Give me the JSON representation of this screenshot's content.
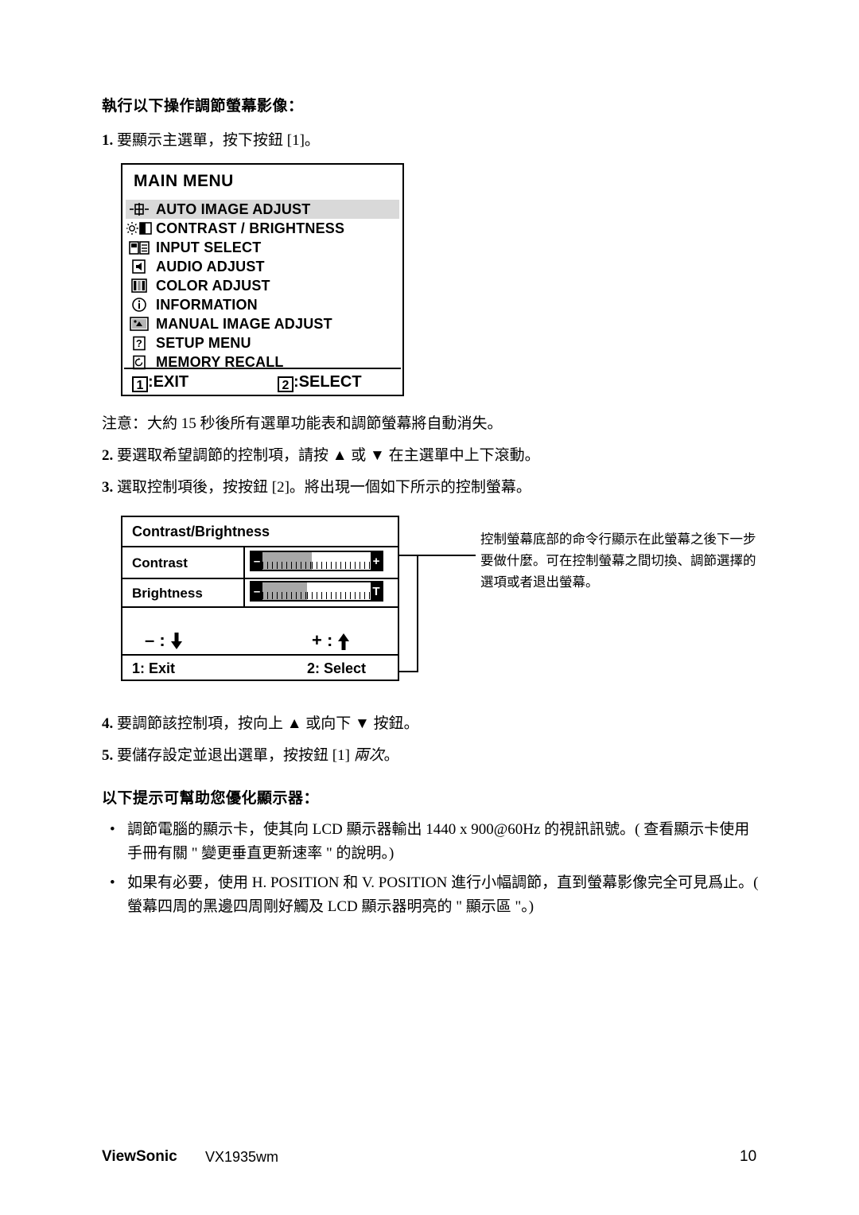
{
  "section1": {
    "heading": "執行以下操作調節螢幕影像：",
    "step1_num": "1.",
    "step1_text": "要顯示主選單，按下按鈕 [1]。",
    "note": "注意：大約 15 秒後所有選單功能表和調節螢幕將自動消失。",
    "step2_num": "2.",
    "step2_text": "要選取希望調節的控制項，請按 ▲ 或 ▼ 在主選單中上下滾動。",
    "step3_num": "3.",
    "step3_text": "選取控制項後，按按鈕 [2]。將出現一個如下所示的控制螢幕。",
    "step4_num": "4.",
    "step4_text": "要調節該控制項，按向上 ▲ 或向下 ▼ 按鈕。",
    "step5_num": "5.",
    "step5_text_a": "要儲存設定並退出選單，按按鈕 [1] ",
    "step5_text_italic": "兩次",
    "step5_text_b": "。"
  },
  "osd_main": {
    "title": "MAIN MENU",
    "items": [
      {
        "label": "AUTO IMAGE ADJUST",
        "icon": "auto-image-adjust-icon",
        "selected": true
      },
      {
        "label": "CONTRAST / BRIGHTNESS",
        "icon": "contrast-brightness-icon",
        "selected": false
      },
      {
        "label": "INPUT SELECT",
        "icon": "input-select-icon",
        "selected": false
      },
      {
        "label": "AUDIO ADJUST",
        "icon": "audio-adjust-icon",
        "selected": false
      },
      {
        "label": "COLOR ADJUST",
        "icon": "color-adjust-icon",
        "selected": false
      },
      {
        "label": "INFORMATION",
        "icon": "information-icon",
        "selected": false
      },
      {
        "label": "MANUAL IMAGE ADJUST",
        "icon": "manual-image-adjust-icon",
        "selected": false
      },
      {
        "label": "SETUP MENU",
        "icon": "setup-menu-icon",
        "selected": false
      },
      {
        "label": "MEMORY RECALL",
        "icon": "memory-recall-icon",
        "selected": false
      }
    ],
    "footer_left_key": "1",
    "footer_left_label": ":EXIT",
    "footer_right_key": "2",
    "footer_right_label": ":SELECT"
  },
  "osd_contrast": {
    "title": "Contrast/Brightness",
    "rows": [
      {
        "label": "Contrast",
        "minus": "–",
        "plus": "+",
        "fill_percent": 48
      },
      {
        "label": "Brightness",
        "minus": "–",
        "plus": "T",
        "fill_percent": 44
      }
    ],
    "minus_symbol": "–  :",
    "plus_symbol": "+  :",
    "footer_left": "1: Exit",
    "footer_right": "2: Select"
  },
  "callout": {
    "text": "控制螢幕底部的命令行顯示在此螢幕之後下一步要做什麼。可在控制螢幕之間切換、調節選擇的選項或者退出螢幕。"
  },
  "section2": {
    "heading": "以下提示可幫助您優化顯示器：",
    "bullets": [
      "調節電腦的顯示卡，使其向 LCD 顯示器輸出 1440 x 900@60Hz 的視訊訊號。( 查看顯示卡使用手冊有關 \" 變更垂直更新速率 \" 的說明。)",
      "如果有必要，使用 H. POSITION 和 V. POSITION 進行小幅調節，直到螢幕影像完全可見爲止。( 螢幕四周的黑邊四周剛好觸及 LCD 顯示器明亮的 \" 顯示區 \"。)"
    ],
    "bullet_marker": "•"
  },
  "footer": {
    "brand": "ViewSonic",
    "model": "VX1935wm",
    "page": "10"
  }
}
